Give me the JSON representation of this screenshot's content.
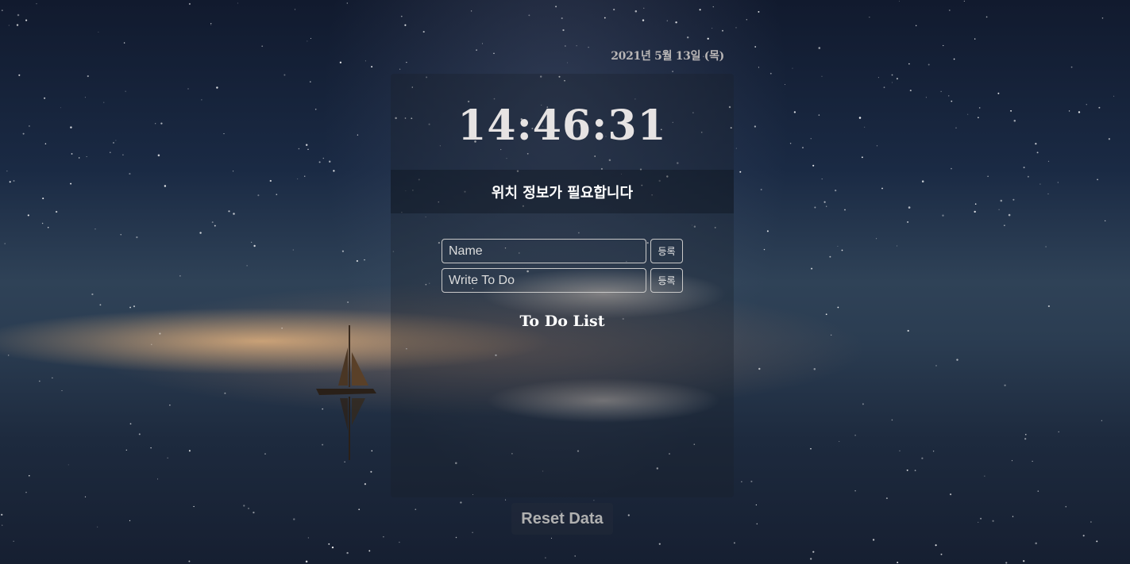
{
  "date_text": "2021년 5월 13일 (목)",
  "clock_text": "14:46:31",
  "weather_message": "위치 정보가 필요합니다",
  "name_input": {
    "placeholder": "Name",
    "button_label": "등록"
  },
  "todo_input": {
    "placeholder": "Write To Do",
    "button_label": "등록"
  },
  "todo_list_title": "To Do List",
  "reset_label": "Reset Data"
}
